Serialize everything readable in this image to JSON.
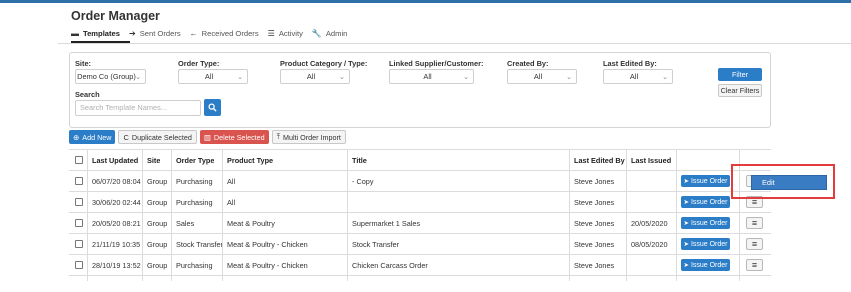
{
  "app": {
    "title": "Order Manager"
  },
  "nav": {
    "tabs": [
      {
        "label": "Templates",
        "icon": "inbox-tray-icon",
        "active": true
      },
      {
        "label": "Sent Orders",
        "icon": "arrow-right-icon",
        "active": false
      },
      {
        "label": "Received Orders",
        "icon": "arrow-left-icon",
        "active": false
      },
      {
        "label": "Activity",
        "icon": "list-icon",
        "active": false
      },
      {
        "label": "Admin",
        "icon": "wrench-icon",
        "active": false
      }
    ]
  },
  "filters": {
    "site": {
      "label": "Site:",
      "value": "Demo Co (Group)"
    },
    "order_type": {
      "label": "Order Type:",
      "value": "All"
    },
    "category": {
      "label": "Product Category / Type:",
      "value": "All"
    },
    "linked": {
      "label": "Linked Supplier/Customer:",
      "value": "All"
    },
    "created_by": {
      "label": "Created By:",
      "value": "All"
    },
    "last_edited_by": {
      "label": "Last Edited By:",
      "value": "All"
    },
    "search": {
      "label": "Search",
      "placeholder": "Search Template Names..."
    },
    "filter_label": "Filter",
    "clear_label": "Clear Filters"
  },
  "actions": {
    "add_new": "Add New",
    "duplicate": "Duplicate Selected",
    "delete": "Delete Selected",
    "import": "Multi Order Import"
  },
  "table": {
    "columns": [
      "Last Updated",
      "Site",
      "Order Type",
      "Product Type",
      "Title",
      "Last Edited By",
      "Last Issued"
    ],
    "issue_label": "Issue Order",
    "rows": [
      {
        "updated": "06/07/20 08:04",
        "site": "Group",
        "type": "Purchasing",
        "product": "All",
        "title": "- Copy",
        "editor": "Steve Jones",
        "issued": ""
      },
      {
        "updated": "30/06/20 02:44",
        "site": "Group",
        "type": "Purchasing",
        "product": "All",
        "title": "",
        "editor": "Steve Jones",
        "issued": ""
      },
      {
        "updated": "20/05/20 08:21",
        "site": "Group",
        "type": "Sales",
        "product": "Meat & Poultry",
        "title": "Supermarket 1 Sales",
        "editor": "Steve Jones",
        "issued": "20/05/2020"
      },
      {
        "updated": "21/11/19 10:35",
        "site": "Group",
        "type": "Stock Transfer",
        "product": "Meat & Poultry - Chicken",
        "title": "Stock Transfer",
        "editor": "Steve Jones",
        "issued": "08/05/2020"
      },
      {
        "updated": "28/10/19 13:52",
        "site": "Group",
        "type": "Purchasing",
        "product": "Meat & Poultry - Chicken",
        "title": "Chicken Carcass Order",
        "editor": "Steve Jones",
        "issued": ""
      }
    ]
  },
  "row_menu": {
    "items": [
      "Edit"
    ]
  },
  "colors": {
    "primary": "#2c7dc7",
    "danger": "#d9534f",
    "highlight": "#e23c3c",
    "menu": "#3a7cc3"
  }
}
